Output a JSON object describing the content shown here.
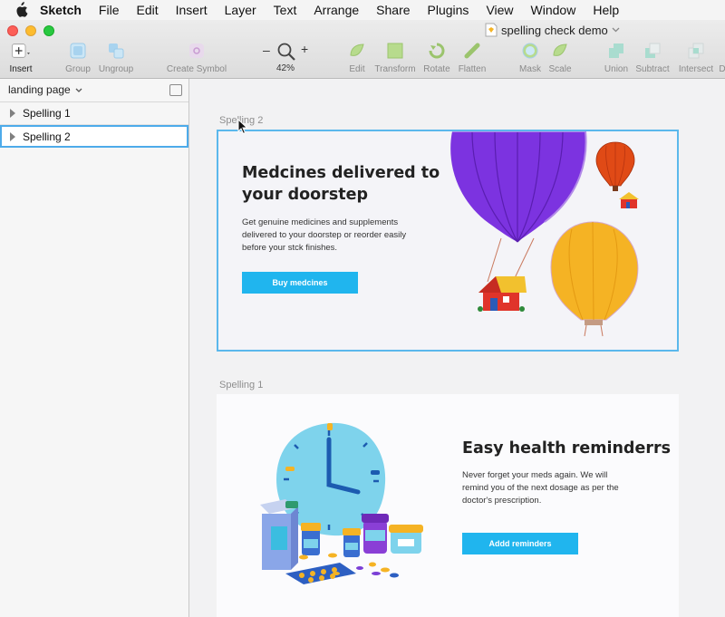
{
  "menubar": {
    "app_name": "Sketch",
    "items": [
      "File",
      "Edit",
      "Insert",
      "Layer",
      "Text",
      "Arrange",
      "Share",
      "Plugins",
      "View",
      "Window",
      "Help"
    ]
  },
  "window": {
    "document_title": "spelling check demo"
  },
  "toolbar": {
    "insert": "Insert",
    "group": "Group",
    "ungroup": "Ungroup",
    "create_symbol": "Create Symbol",
    "zoom_minus": "–",
    "zoom_plus": "+",
    "zoom_level": "42%",
    "edit": "Edit",
    "transform": "Transform",
    "rotate": "Rotate",
    "flatten": "Flatten",
    "mask": "Mask",
    "scale": "Scale",
    "union": "Union",
    "subtract": "Subtract",
    "intersect": "Intersect",
    "difference": "D"
  },
  "sidebar": {
    "page_name": "landing page",
    "layers": [
      {
        "label": "Spelling 1",
        "selected": false
      },
      {
        "label": "Spelling 2",
        "selected": true
      }
    ]
  },
  "canvas": {
    "artboard2": {
      "label": "Spelling 2",
      "heading": "Medcines delivered to your doorstep",
      "heading_line1": "Medcines delivered to",
      "heading_line2": "your doorstep",
      "body_line1": "Get genuine medicines and supplements",
      "body_line2": "delivered to your doorstep or reorder easily",
      "body_line3": "before your stck finishes.",
      "button": "Buy medcines"
    },
    "artboard1": {
      "label": "Spelling 1",
      "heading": "Easy health reminderrs",
      "body_line1": "Never forget your meds again. We will",
      "body_line2": "remind you of the next dosage as per the",
      "body_line3": "doctor's prescription.",
      "button": "Addd reminders"
    }
  },
  "colors": {
    "accent": "#20b5ee",
    "selection": "#4dabea",
    "balloon_purple": "#7c33e0",
    "balloon_orange": "#f5b324",
    "balloon_red": "#e04a16",
    "clock": "#7ed3ec"
  }
}
